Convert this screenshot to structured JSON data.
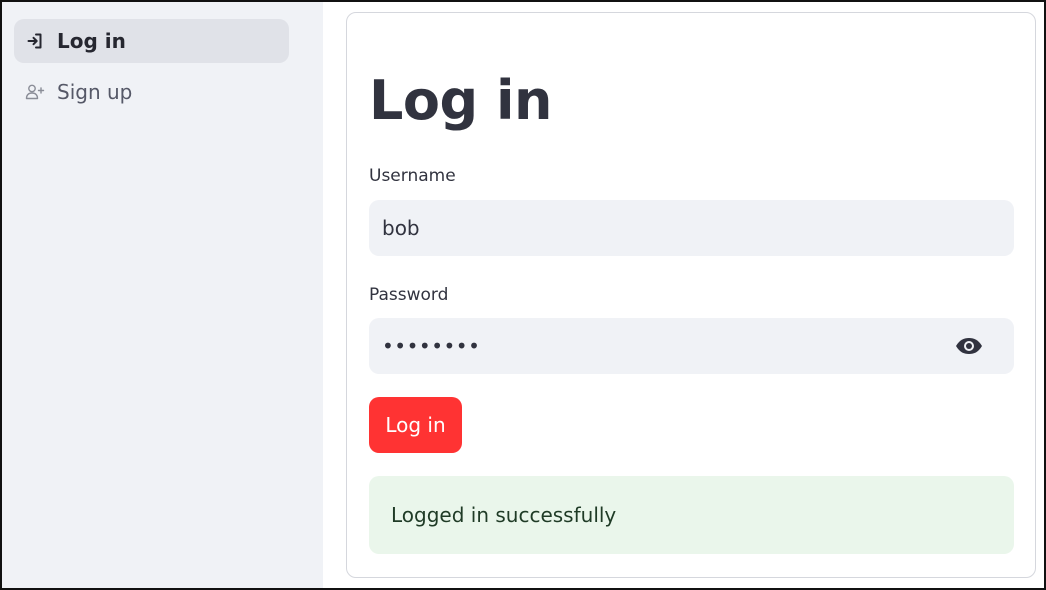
{
  "sidebar": {
    "items": [
      {
        "label": "Log in",
        "icon": "login-icon",
        "active": true
      },
      {
        "label": "Sign up",
        "icon": "person-add-icon",
        "active": false
      }
    ]
  },
  "main": {
    "title": "Log in",
    "username": {
      "label": "Username",
      "value": "bob"
    },
    "password": {
      "label": "Password",
      "value": "••••••••",
      "toggle_icon": "eye-icon"
    },
    "submit_label": "Log in",
    "alert": {
      "text": "Logged in successfully",
      "type": "success"
    }
  },
  "colors": {
    "sidebar_bg": "#f0f2f6",
    "input_bg": "#f0f2f6",
    "primary_button": "#ff3333",
    "success_bg": "#eaf6eb",
    "text": "#31333f"
  }
}
